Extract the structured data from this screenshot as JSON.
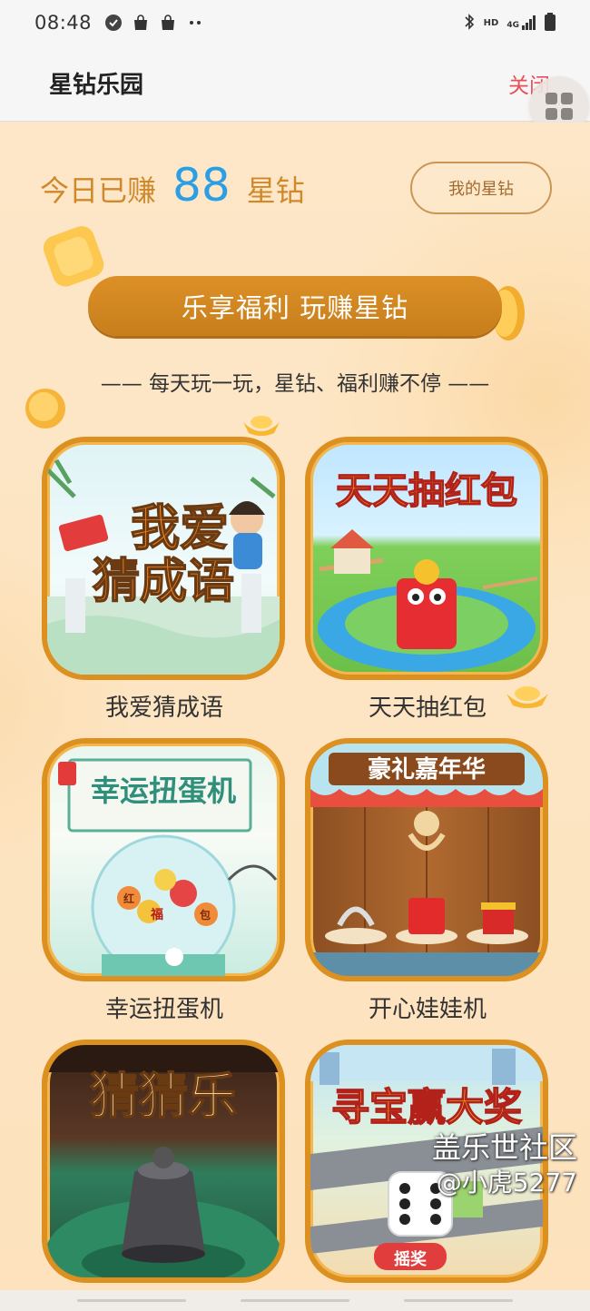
{
  "status_bar": {
    "time": "08:48",
    "left_icons": [
      "shield-check-icon",
      "shopping-bag-icon",
      "shopping-bag-icon",
      "more-dots-icon"
    ],
    "right_icons": [
      "bluetooth-icon",
      "hd-icon",
      "4g-signal-icon",
      "battery-icon"
    ],
    "hd_label": "HD",
    "net_label": "4G"
  },
  "app_bar": {
    "title": "星钻乐园",
    "close_label": "关闭"
  },
  "earned": {
    "prefix": "今日已赚",
    "value": "88",
    "unit": "星钻",
    "my_stars_button": "我的星钻"
  },
  "banner": {
    "text": "乐享福利 玩赚星钻"
  },
  "tagline": "—— 每天玩一玩，星钻、福利赚不停 ——",
  "games": [
    {
      "name": "我爱猜成语",
      "art_title_1": "我爱",
      "art_title_2": "猜成语"
    },
    {
      "name": "天天抽红包",
      "art_title": "天天抽红包"
    },
    {
      "name": "幸运扭蛋机",
      "art_title": "幸运扭蛋机",
      "art_ball_1": "福",
      "art_ball_2": "红",
      "art_ball_3": "包"
    },
    {
      "name": "开心娃娃机",
      "art_title": "豪礼嘉年华"
    },
    {
      "name": "",
      "art_title": "猜猜乐"
    },
    {
      "name": "",
      "art_title": "寻宝赢大奖",
      "art_button": "摇奖"
    }
  ],
  "watermark": {
    "line1": "盖乐世社区",
    "line2": "@小虎5277"
  },
  "colors": {
    "accent_orange": "#dc901f",
    "value_blue": "#2c9fe4",
    "close_red": "#e8505b",
    "background": "#fde6c6"
  }
}
